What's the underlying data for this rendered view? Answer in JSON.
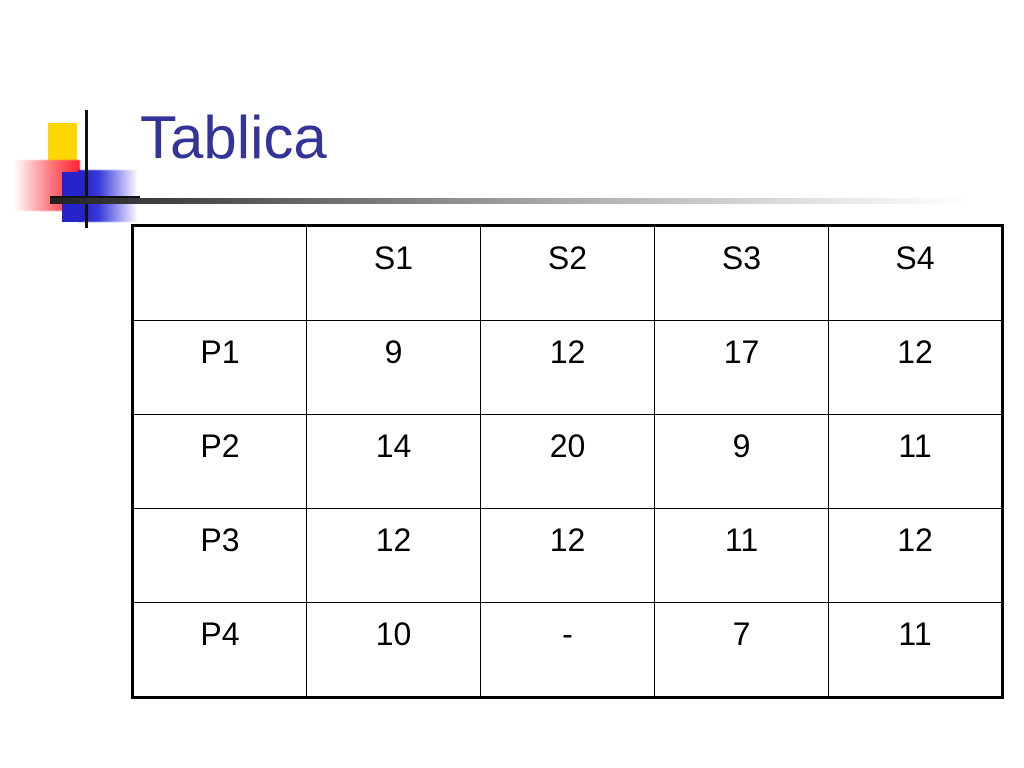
{
  "slide": {
    "title": "Tablica"
  },
  "colors": {
    "title": "#333399",
    "logo_yellow": "#FFD700",
    "logo_red": "#FF2030",
    "logo_blue": "#2424C8"
  },
  "table": {
    "header": [
      "",
      "S1",
      "S2",
      "S3",
      "S4"
    ],
    "rows": [
      [
        "P1",
        "9",
        "12",
        "17",
        "12"
      ],
      [
        "P2",
        "14",
        "20",
        "9",
        "11"
      ],
      [
        "P3",
        "12",
        "12",
        "11",
        "12"
      ],
      [
        "P4",
        "10",
        "-",
        "7",
        "11"
      ]
    ]
  }
}
